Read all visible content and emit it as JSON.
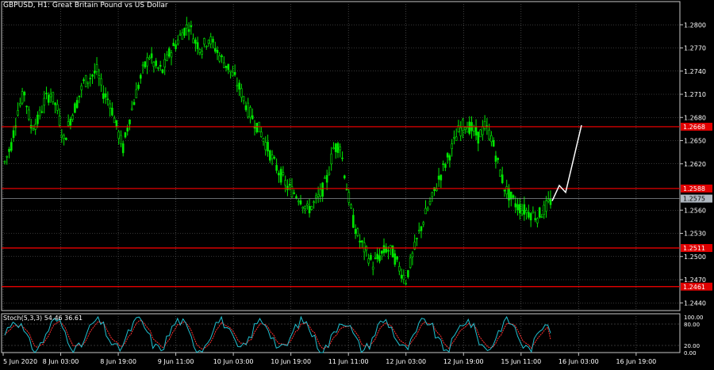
{
  "title": "GBPUSD, H1:  Great Britain Pound vs US Dollar",
  "stoch_label": "Stoch(5,3,3) 54.46 36.61",
  "colors": {
    "background": "#000000",
    "grid": "#6b6b6b",
    "candle": "#00e600",
    "level_line": "#ff0000",
    "level_label_bg": "#e00000",
    "current_price_bg": "#b0b8c0",
    "projection": "#ffffff",
    "stoch_main": "#20c0d0",
    "stoch_signal": "#ff3030"
  },
  "chart_data": {
    "type": "candlestick",
    "symbol": "GBPUSD",
    "timeframe": "H1",
    "ylim": [
      1.243,
      1.283
    ],
    "y_ticks": [
      "1.2800",
      "1.2770",
      "1.2740",
      "1.2710",
      "1.2680",
      "1.2650",
      "1.2620",
      "1.2560",
      "1.2530",
      "1.2500",
      "1.2470",
      "1.2440"
    ],
    "x_ticks": [
      "5 Jun 2020",
      "8 Jun 03:00",
      "8 Jun 19:00",
      "9 Jun 11:00",
      "10 Jun 03:00",
      "10 Jun 19:00",
      "11 Jun 11:00",
      "12 Jun 03:00",
      "12 Jun 19:00",
      "15 Jun 11:00",
      "16 Jun 03:00",
      "16 Jun 19:00"
    ],
    "levels": [
      {
        "label": "1.2668",
        "value": 1.2668
      },
      {
        "label": "1.2588",
        "value": 1.2588
      },
      {
        "label": "1.2511",
        "value": 1.2511
      },
      {
        "label": "1.2461",
        "value": 1.2461
      }
    ],
    "current_price": {
      "label": "1.2575",
      "value": 1.2575
    },
    "close_path": [
      1.2622,
      1.2645,
      1.269,
      1.2712,
      1.2668,
      1.2675,
      1.27,
      1.2712,
      1.269,
      1.265,
      1.2678,
      1.27,
      1.2725,
      1.2732,
      1.274,
      1.2712,
      1.27,
      1.2668,
      1.264,
      1.268,
      1.2712,
      1.274,
      1.276,
      1.2745,
      1.274,
      1.2762,
      1.2775,
      1.279,
      1.28,
      1.2778,
      1.277,
      1.2783,
      1.277,
      1.2755,
      1.2745,
      1.273,
      1.2712,
      1.269,
      1.2675,
      1.266,
      1.264,
      1.262,
      1.2605,
      1.259,
      1.2583,
      1.2575,
      1.256,
      1.2568,
      1.258,
      1.26,
      1.264,
      1.2645,
      1.259,
      1.2545,
      1.252,
      1.2505,
      1.249,
      1.25,
      1.251,
      1.2505,
      1.2485,
      1.247,
      1.25,
      1.253,
      1.2555,
      1.2575,
      1.26,
      1.262,
      1.264,
      1.2662,
      1.2672,
      1.2665,
      1.2655,
      1.2668,
      1.2655,
      1.262,
      1.259,
      1.2575,
      1.2565,
      1.256,
      1.2556,
      1.2552,
      1.256,
      1.2572
    ],
    "projection": [
      1.2572,
      1.2592,
      1.2583,
      1.267
    ],
    "stochastic": {
      "label": "Stoch(5,3,3)",
      "main": 54.46,
      "signal": 36.61,
      "levels": [
        "80.00",
        "20.00"
      ],
      "scale_labels": [
        "100.00",
        "80.00",
        "20.00",
        "0.00"
      ]
    }
  }
}
